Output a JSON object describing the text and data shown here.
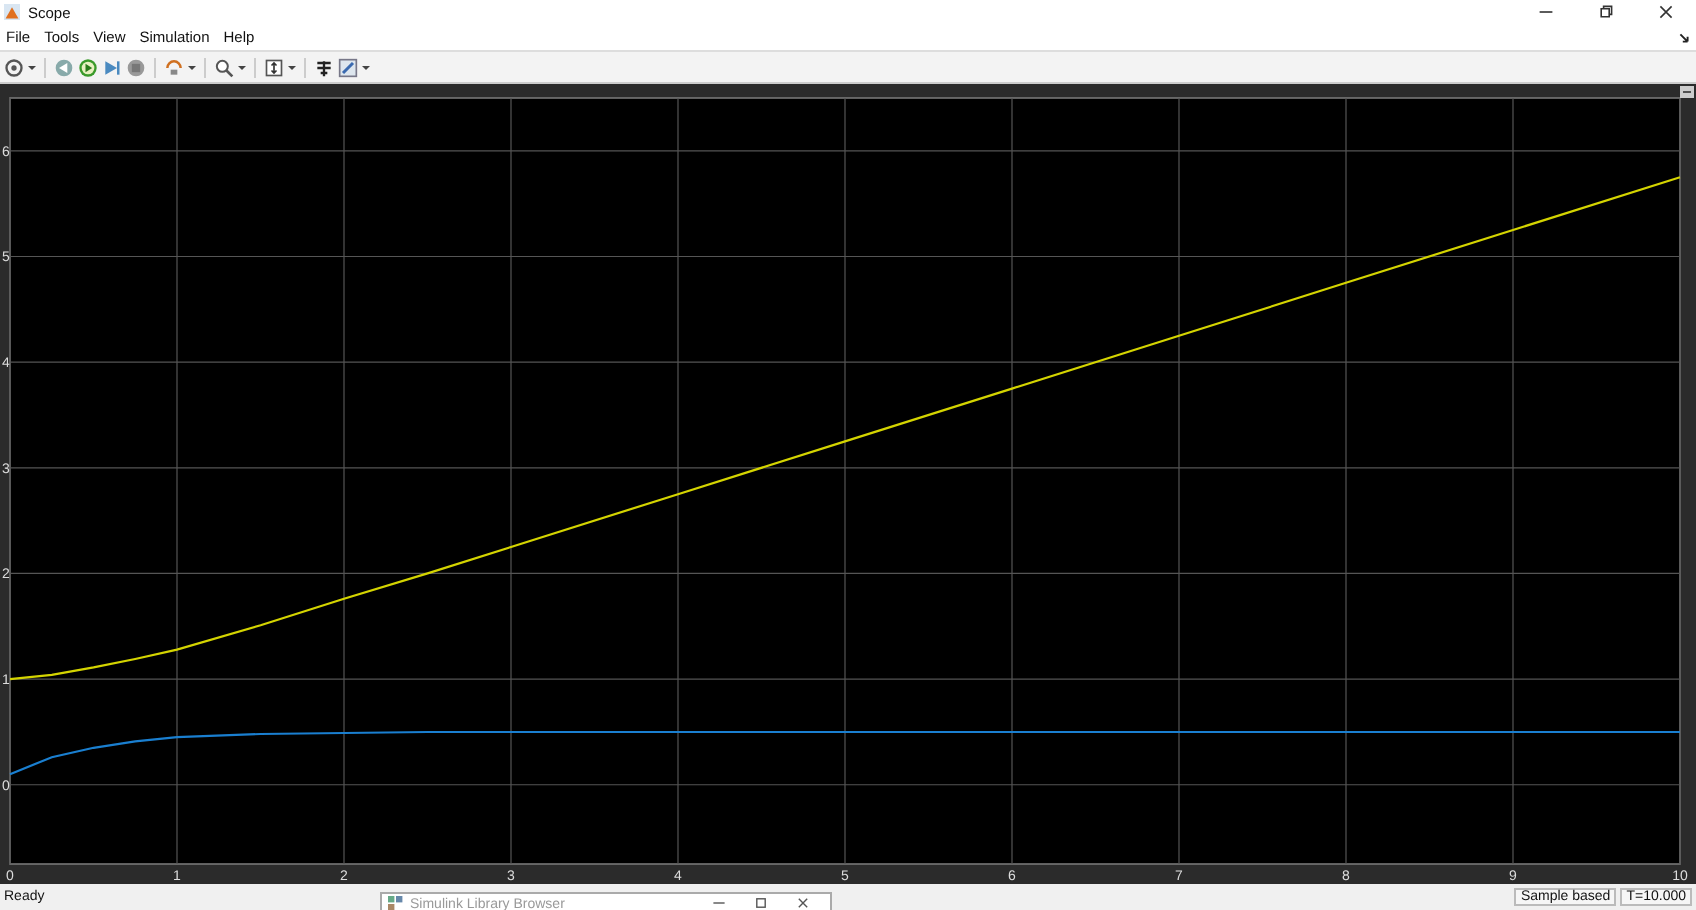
{
  "window": {
    "title": "Scope"
  },
  "menu": [
    "File",
    "Tools",
    "View",
    "Simulation",
    "Help"
  ],
  "plot": {
    "chart_data": {
      "type": "line",
      "x": [
        0,
        0.25,
        0.5,
        0.75,
        1,
        1.5,
        2,
        2.5,
        3,
        4,
        5,
        6,
        7,
        8,
        9,
        10
      ],
      "series": [
        {
          "color": "#d4d400",
          "values": [
            1,
            1.04,
            1.11,
            1.19,
            1.28,
            1.51,
            1.76,
            2.0,
            2.25,
            2.75,
            3.25,
            3.75,
            4.25,
            4.75,
            5.25,
            5.75
          ]
        },
        {
          "color": "#1a7fd0",
          "values": [
            0.1,
            0.26,
            0.35,
            0.41,
            0.45,
            0.48,
            0.49,
            0.5,
            0.5,
            0.5,
            0.5,
            0.5,
            0.5,
            0.5,
            0.5,
            0.5
          ]
        }
      ],
      "grid": true,
      "xlim": [
        0,
        10
      ],
      "ylim": [
        -0.75,
        6.5
      ],
      "xticks": [
        0,
        1,
        2,
        3,
        4,
        5,
        6,
        7,
        8,
        9,
        10
      ],
      "yticks": [
        0,
        1,
        2,
        3,
        4,
        5,
        6
      ]
    }
  },
  "status_bar": {
    "status": "Ready",
    "mode": "Sample based",
    "time": "T=10.000"
  },
  "overlay_window": {
    "title": "Simulink Library Browser"
  }
}
